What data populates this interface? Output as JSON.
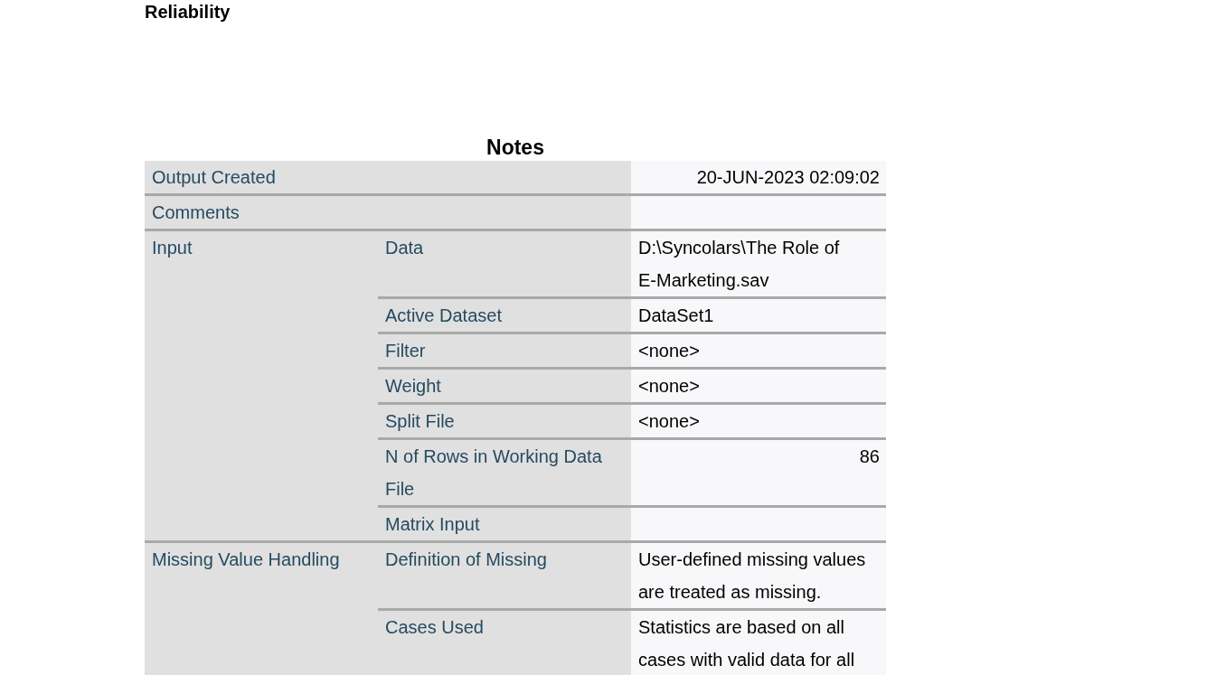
{
  "heading": "Reliability",
  "table": {
    "title": "Notes",
    "groups": [
      {
        "label": "Output Created",
        "value": "20-JUN-2023 02:09:02",
        "kind": "number"
      },
      {
        "label": "Comments"
      },
      {
        "label": "Input",
        "rows": [
          {
            "label": "Data",
            "value": "D:\\Syncolars\\The Role of E-Marketing.sav",
            "kind": "text"
          },
          {
            "label": "Active Dataset",
            "value": "DataSet1",
            "kind": "text"
          },
          {
            "label": "Filter",
            "value": "<none>",
            "kind": "text"
          },
          {
            "label": "Weight",
            "value": "<none>",
            "kind": "text"
          },
          {
            "label": "Split File",
            "value": "<none>",
            "kind": "text"
          },
          {
            "label": "N of Rows in Working Data File",
            "value": "86",
            "kind": "number"
          },
          {
            "label": "Matrix Input"
          }
        ]
      },
      {
        "label": "Missing Value Handling",
        "rows": [
          {
            "label": "Definition of Missing",
            "value": "User-defined missing values are treated as missing.",
            "kind": "text"
          },
          {
            "label": "Cases Used",
            "value": "Statistics are based on all cases with valid data for all",
            "kind": "text"
          }
        ]
      }
    ]
  }
}
